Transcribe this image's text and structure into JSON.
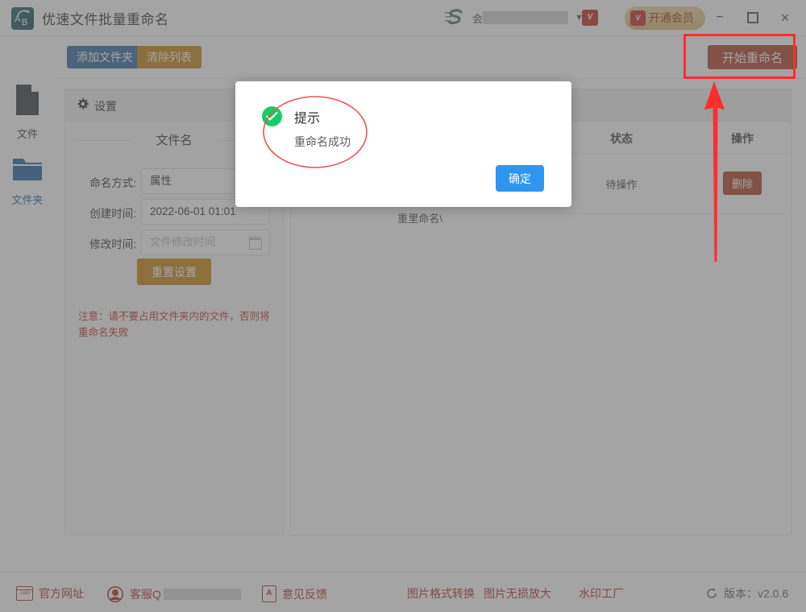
{
  "titlebar": {
    "app_name": "优速文件批量重命名",
    "icon_letters": {
      "a": "A",
      "b": "B"
    },
    "account_prefix": "会",
    "account_redacted": "",
    "vip_chip": "V",
    "vip_button": "开通会员",
    "minimize": "−",
    "close": "×"
  },
  "sidebar": {
    "items": [
      {
        "label": "文件",
        "icon": "file-icon",
        "active": false
      },
      {
        "label": "文件夹",
        "icon": "folder-icon",
        "active": true
      }
    ]
  },
  "toolbar": {
    "add_folder": "添加文件夹",
    "clear_list": "清除列表",
    "start_rename": "开始重命名"
  },
  "settings": {
    "header": "设置",
    "section_title": "文件名",
    "fields": [
      {
        "label": "命名方式:",
        "value": "属性",
        "placeholder": "",
        "type": "select"
      },
      {
        "label": "创建时间:",
        "value": "2022-06-01 01:01",
        "placeholder": "",
        "type": "text"
      },
      {
        "label": "修改时间:",
        "value": "",
        "placeholder": "文件修改时间",
        "type": "date"
      }
    ],
    "reset_button": "重置设置",
    "note": "注意：请不要占用文件夹内的文件，否则将重命名失败"
  },
  "table": {
    "headers": [
      "",
      "状态",
      "操作"
    ],
    "rows": [
      {
        "path": "mi\n刂\n批\n重里命名\\",
        "status": "待操作",
        "action": "删除"
      }
    ]
  },
  "dialog": {
    "title": "提示",
    "message": "重命名成功",
    "confirm": "确定",
    "icon": "success-check-icon"
  },
  "bottombar": {
    "official_site": "官方网址",
    "service_label": "客服Q",
    "service_redacted": "",
    "feedback": "意见反馈",
    "pdf_icon_text": "A",
    "web_icon_text": ".com",
    "links": [
      "图片格式转换",
      "图片无损放大",
      "水印工厂"
    ],
    "version": "版本：v2.0.6"
  },
  "annotations": {
    "highlight_target": "start-rename-button",
    "ellipse_target": "dialog-text",
    "arrow_color": "#ff2d2d",
    "rect_color": "#ff2d2d",
    "ellipse_color": "#ef5350"
  }
}
